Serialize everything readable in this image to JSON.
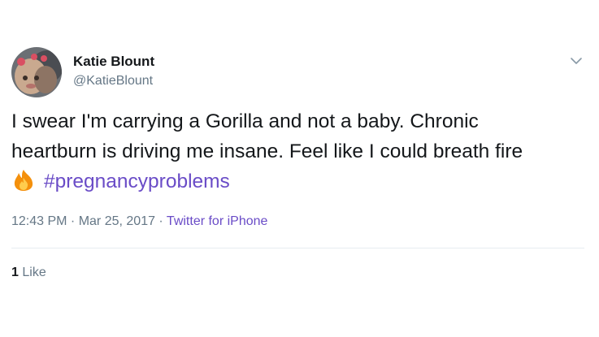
{
  "tweet": {
    "author_name": "Katie Blount",
    "author_handle": "@KatieBlount",
    "text_line1": "I swear I'm carrying a Gorilla and not a baby. Chronic",
    "text_line2": "heartburn is driving me insane. Feel like I could breath fire",
    "hashtag": "#pregnancyproblems",
    "emoji_icon": "fire-icon",
    "time": "12:43 PM",
    "separator": " · ",
    "date": "Mar 25, 2017",
    "source": "Twitter for iPhone",
    "likes_count": "1",
    "likes_label": "Like"
  },
  "colors": {
    "name": "#14171a",
    "secondary": "#657786",
    "link": "#6a4cc7",
    "divider": "#e6ecf0"
  }
}
